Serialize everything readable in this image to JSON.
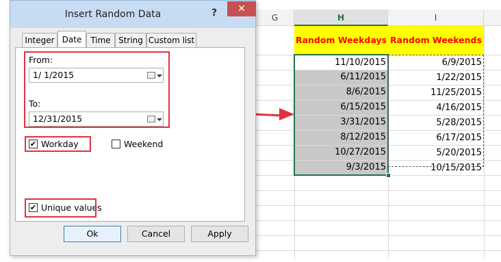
{
  "dialog": {
    "title": "Insert Random Data",
    "help_label": "?",
    "close_label": "✕",
    "tabs": [
      {
        "label": "Integer"
      },
      {
        "label": "Date"
      },
      {
        "label": "Time"
      },
      {
        "label": "String"
      },
      {
        "label": "Custom list"
      }
    ],
    "active_tab": "Date",
    "from_label": "From:",
    "from_value": "1/  1/2015",
    "to_label": "To:",
    "to_value": "12/31/2015",
    "workday": {
      "label": "Workday",
      "checked": true,
      "mark": "✔"
    },
    "weekend": {
      "label": "Weekend",
      "checked": false,
      "mark": ""
    },
    "unique": {
      "label": "Unique values",
      "checked": true,
      "mark": "✔"
    },
    "buttons": {
      "ok": "Ok",
      "cancel": "Cancel",
      "apply": "Apply"
    }
  },
  "sheet": {
    "columns": [
      {
        "label": "G"
      },
      {
        "label": "H"
      },
      {
        "label": "I"
      }
    ],
    "selected_column": "H",
    "header_h": "Random Weekdays",
    "header_i": "Random Weekends",
    "weekdays": [
      "11/10/2015",
      "6/11/2015",
      "8/6/2015",
      "6/15/2015",
      "3/31/2015",
      "8/12/2015",
      "10/27/2015",
      "9/3/2015"
    ],
    "weekends": [
      "6/9/2015",
      "1/22/2015",
      "11/25/2015",
      "4/16/2015",
      "5/28/2015",
      "6/17/2015",
      "5/20/2015",
      "10/15/2015"
    ]
  },
  "colors": {
    "accent_red": "#e0323c",
    "header_fill": "#ffff00",
    "header_text": "#ff0000",
    "selection": "#217346",
    "shade": "#c8c8c8"
  }
}
